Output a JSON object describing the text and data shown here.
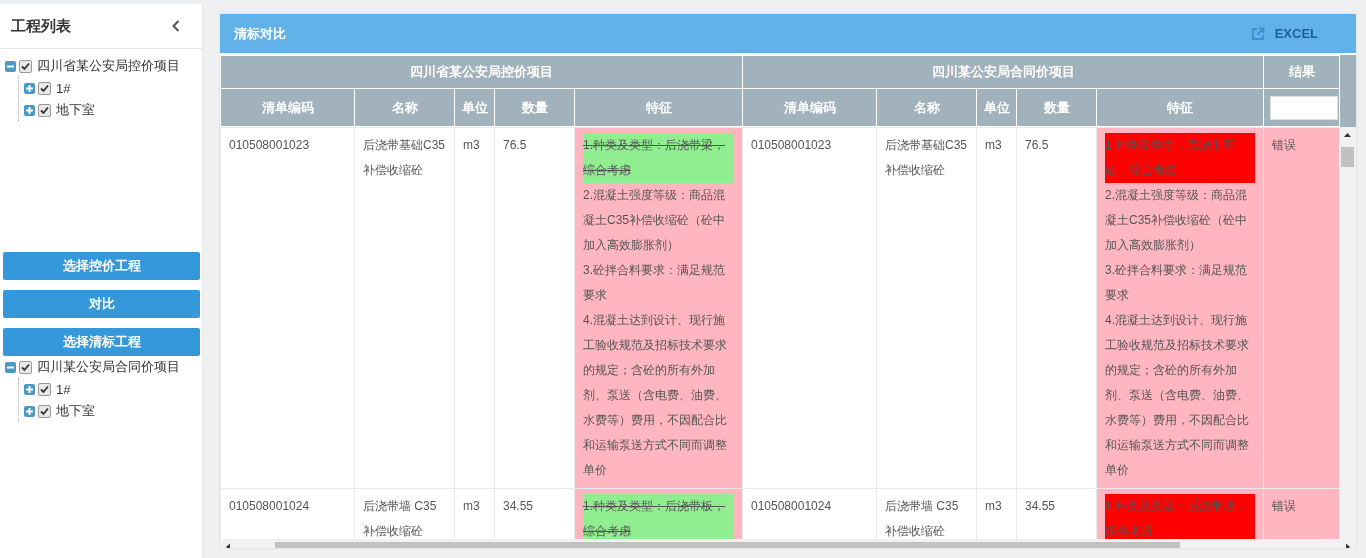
{
  "sidebar": {
    "title": "工程列表",
    "control_tree": [
      {
        "label": "四川省某公安局控价项目",
        "expanded": true,
        "checked": true,
        "children": [
          {
            "label": "1#",
            "expanded": false,
            "checked": true
          },
          {
            "label": "地下室",
            "expanded": false,
            "checked": true
          }
        ]
      }
    ],
    "buttons": [
      "选择控价工程",
      "对比",
      "选择清标工程"
    ],
    "bid_tree": [
      {
        "label": "四川某公安局合同价项目",
        "expanded": true,
        "checked": true,
        "children": [
          {
            "label": "1#",
            "expanded": false,
            "checked": true
          },
          {
            "label": "地下室",
            "expanded": false,
            "checked": true
          }
        ]
      }
    ]
  },
  "panel": {
    "title": "清标对比",
    "export_button": "EXCEL",
    "table": {
      "groups": [
        "四川省某公安局控价项目",
        "四川某公安局合同价项目",
        "结果"
      ],
      "columns": [
        "清单编码",
        "名称",
        "单位",
        "数量",
        "特征",
        "清单编码",
        "名称",
        "单位",
        "数量",
        "特征"
      ],
      "rows": [
        {
          "mismatch": true,
          "result": "错误",
          "left": {
            "code": "010508001023",
            "name": "后浇带基础C35补偿收缩砼",
            "unit": "m3",
            "qty": "76.5",
            "features": [
              {
                "text": "1.种类及类型：后浇带梁，综合考虑",
                "removed": true,
                "added": false
              },
              {
                "text": "2.混凝土强度等级：商品混凝土C35补偿收缩砼（砼中加入高效膨胀剂）",
                "removed": false,
                "added": false
              },
              {
                "text": "3.砼拌合料要求：满足规范要求",
                "removed": false,
                "added": false
              },
              {
                "text": "4.混凝土达到设计、现行施工验收规范及招标技术要求的规定；含砼的所有外加剂、泵送（含电费、油费、水费等）费用，不因配合比和运输泵送方式不同而调整单价",
                "removed": false,
                "added": false
              }
            ]
          },
          "right": {
            "code": "010508001023",
            "name": "后浇带基础C35补偿收缩砼",
            "unit": "m3",
            "qty": "76.5",
            "features": [
              {
                "text": "1.种类及类型：后浇带基础，综合考虑",
                "removed": false,
                "added": true
              },
              {
                "text": "2.混凝土强度等级：商品混凝土C35补偿收缩砼（砼中加入高效膨胀剂）",
                "removed": false,
                "added": false
              },
              {
                "text": "3.砼拌合料要求：满足规范要求",
                "removed": false,
                "added": false
              },
              {
                "text": "4.混凝土达到设计、现行施工验收规范及招标技术要求的规定；含砼的所有外加剂、泵送（含电费、油费、水费等）费用，不因配合比和运输泵送方式不同而调整单价",
                "removed": false,
                "added": false
              }
            ]
          }
        },
        {
          "mismatch": true,
          "result": "错误",
          "left": {
            "code": "010508001024",
            "name": "后浇带墙 C35补偿收缩砼",
            "unit": "m3",
            "qty": "34.55",
            "features": [
              {
                "text": "1.种类及类型：后浇带板，综合考虑",
                "removed": true,
                "added": false
              }
            ]
          },
          "right": {
            "code": "010508001024",
            "name": "后浇带墙 C35补偿收缩砼",
            "unit": "m3",
            "qty": "34.55",
            "features": [
              {
                "text": "1.种类及类型：后浇带墙，综合考虑",
                "removed": false,
                "added": true
              }
            ]
          }
        }
      ]
    }
  }
}
